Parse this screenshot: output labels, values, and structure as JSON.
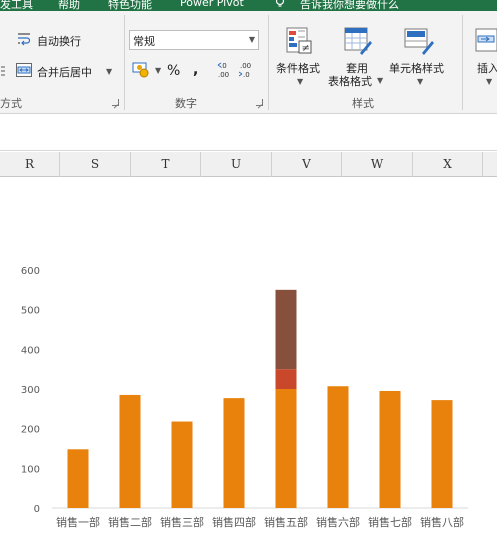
{
  "title_bar": {
    "tabs": [
      "发工具",
      "帮助",
      "特色功能",
      "Power Pivot"
    ],
    "tell_me": "告诉我你想要做什么"
  },
  "ribbon": {
    "alignment": {
      "wrap_text": "自动换行",
      "merge_center": "合并后居中",
      "group_label": "方式"
    },
    "number": {
      "format_value": "常规",
      "percent": "%",
      "comma": ",",
      "inc_decimal": ".00 ←.0",
      "dec_decimal": ".00 →.0",
      "group_label": "数字"
    },
    "styles": {
      "conditional_formatting": "条件格式",
      "format_as_table_line1": "套用",
      "format_as_table_line2": "表格格式",
      "cell_styles": "单元格样式",
      "group_label": "样式"
    },
    "cells": {
      "insert": "插入"
    }
  },
  "sheet": {
    "columns": [
      "R",
      "S",
      "T",
      "U",
      "V",
      "W",
      "X"
    ]
  },
  "colors": {
    "ribbon_green": "#217346",
    "bar_orange": "#E8820C",
    "overlay_red": "#C9482B",
    "overlay_brown": "#87503C"
  },
  "chart_data": {
    "type": "bar",
    "title": "",
    "xlabel": "",
    "ylabel": "",
    "ylim": [
      0,
      600
    ],
    "yticks": [
      0,
      100,
      200,
      300,
      400,
      500,
      600
    ],
    "grid": false,
    "categories": [
      "销售一部",
      "销售二部",
      "销售三部",
      "销售四部",
      "销售五部",
      "销售六部",
      "销售七部",
      "销售八部"
    ],
    "values": [
      148,
      285,
      218,
      277,
      300,
      307,
      295,
      272
    ],
    "stacked_overlay": {
      "category": "销售五部",
      "segments": [
        {
          "from": 300,
          "to": 350,
          "color": "#C9482B"
        },
        {
          "from": 350,
          "to": 550,
          "color": "#87503C"
        }
      ]
    }
  }
}
